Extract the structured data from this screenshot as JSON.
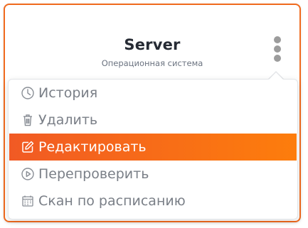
{
  "card": {
    "title": "Server",
    "subtitle": "Операционная система"
  },
  "menu": {
    "items": [
      {
        "label": "История",
        "icon": "clock-icon",
        "active": false
      },
      {
        "label": "Удалить",
        "icon": "trash-icon",
        "active": false
      },
      {
        "label": "Редактировать",
        "icon": "edit-icon",
        "active": true
      },
      {
        "label": "Перепроверить",
        "icon": "play-circle-icon",
        "active": false
      },
      {
        "label": "Скан по расписанию",
        "icon": "calendar-icon",
        "active": false
      }
    ]
  },
  "colors": {
    "accent": "#f06a1e",
    "active_gradient_start": "#f15a24",
    "active_gradient_end": "#fd7d0c",
    "text_muted": "#7a7f87",
    "title": "#262b34"
  }
}
